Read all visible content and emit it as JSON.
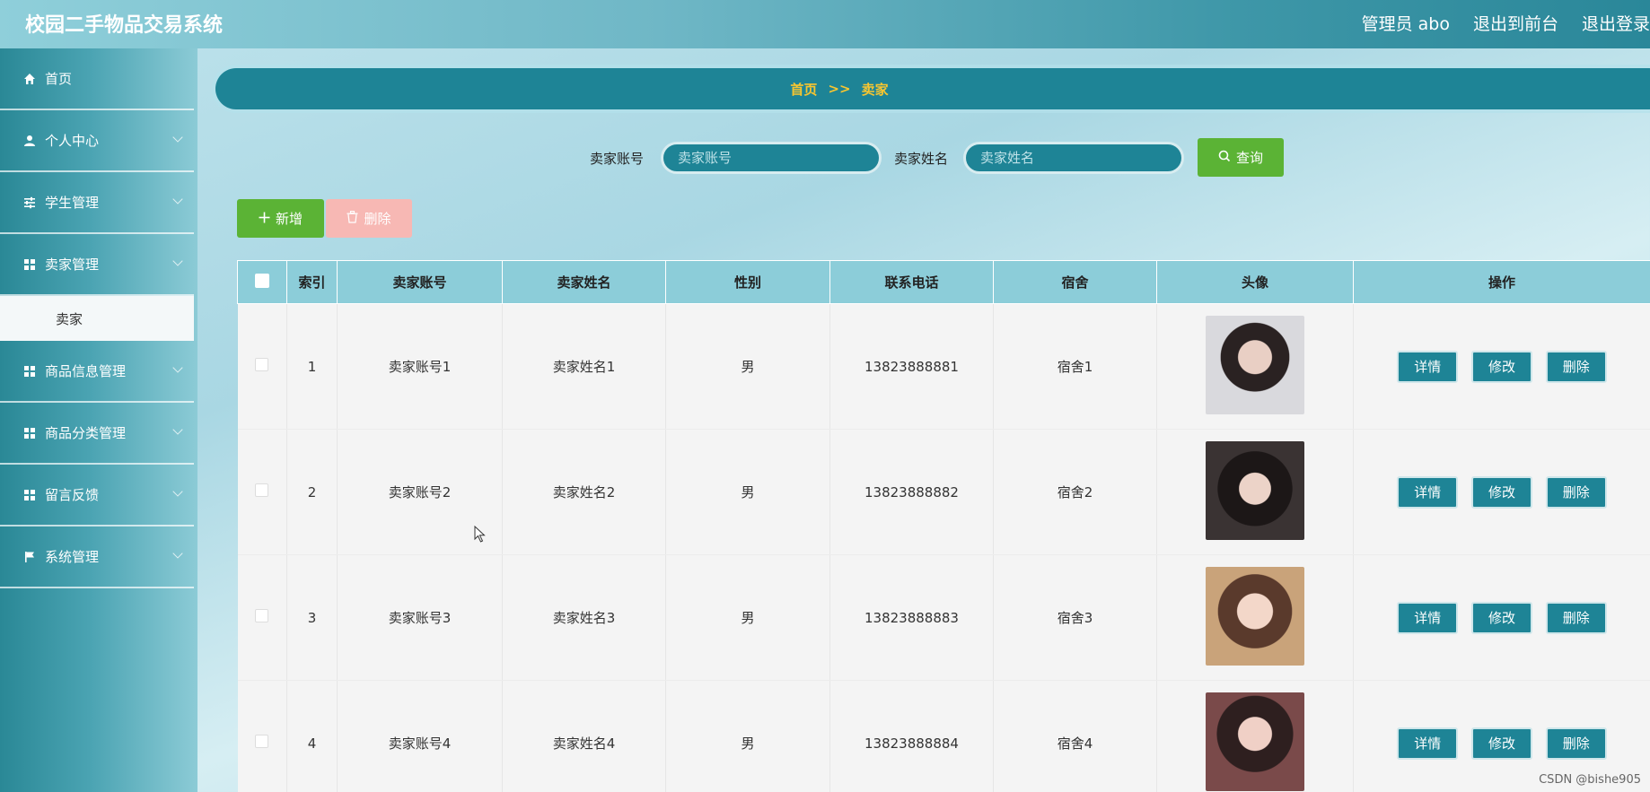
{
  "app": {
    "title": "校园二手物品交易系统"
  },
  "header": {
    "links": [
      "管理员 abo",
      "退出到前台",
      "退出登录"
    ]
  },
  "sidebar": {
    "items": [
      {
        "label": "首页",
        "icon": "home-icon"
      },
      {
        "label": "个人中心",
        "icon": "user-icon"
      },
      {
        "label": "学生管理",
        "icon": "sliders-icon"
      },
      {
        "label": "卖家管理",
        "icon": "grid-icon"
      },
      {
        "label": "商品信息管理",
        "icon": "grid-icon"
      },
      {
        "label": "商品分类管理",
        "icon": "grid-icon"
      },
      {
        "label": "留言反馈",
        "icon": "grid-icon"
      },
      {
        "label": "系统管理",
        "icon": "flag-icon"
      }
    ],
    "sub_item": "卖家"
  },
  "breadcrumb": {
    "home": "首页",
    "separator": ">>",
    "current": "卖家"
  },
  "search": {
    "account_label": "卖家账号",
    "account_placeholder": "卖家账号",
    "name_label": "卖家姓名",
    "name_placeholder": "卖家姓名",
    "query_label": "查询"
  },
  "toolbar": {
    "add_label": "新增",
    "delete_label": "删除"
  },
  "table": {
    "headers": [
      "索引",
      "卖家账号",
      "卖家姓名",
      "性别",
      "联系电话",
      "宿舍",
      "头像",
      "操作"
    ],
    "rows": [
      {
        "index": "1",
        "account": "卖家账号1",
        "name": "卖家姓名1",
        "gender": "男",
        "phone": "13823888881",
        "dorm": "宿舍1"
      },
      {
        "index": "2",
        "account": "卖家账号2",
        "name": "卖家姓名2",
        "gender": "男",
        "phone": "13823888882",
        "dorm": "宿舍2"
      },
      {
        "index": "3",
        "account": "卖家账号3",
        "name": "卖家姓名3",
        "gender": "男",
        "phone": "13823888883",
        "dorm": "宿舍3"
      },
      {
        "index": "4",
        "account": "卖家账号4",
        "name": "卖家姓名4",
        "gender": "男",
        "phone": "13823888884",
        "dorm": "宿舍4"
      }
    ],
    "actions": {
      "detail": "详情",
      "edit": "修改",
      "delete": "删除"
    }
  },
  "watermark": "CSDN @bishe905",
  "colors": {
    "primary": "#1e8496",
    "success": "#5bb335",
    "danger_light": "#f7b8b4",
    "accent_text": "#f7c630"
  }
}
